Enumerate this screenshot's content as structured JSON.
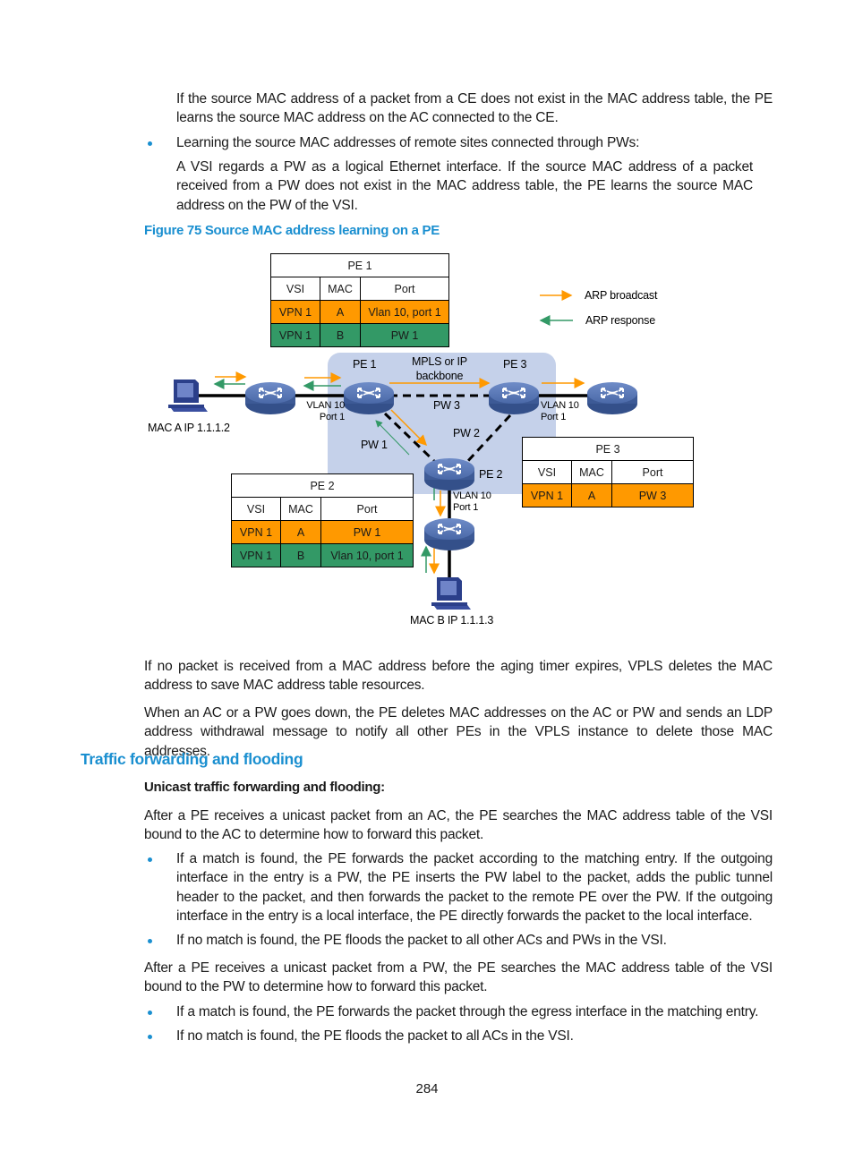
{
  "document": {
    "intro_paragraph": "If the source MAC address of a packet from a CE does not exist in the MAC address table, the PE learns the source MAC address on the AC connected to the CE.",
    "bullet_remote": "Learning the source MAC addresses of remote sites connected through PWs:",
    "remote_paragraph": "A VSI regards a PW as a logical Ethernet interface. If the source MAC address of a packet received from a PW does not exist in the MAC address table, the PE learns the source MAC address on the PW of the VSI.",
    "figure_title": "Figure 75 Source MAC address learning on a PE",
    "aging_paragraph": "If no packet is received from a MAC address before the aging timer expires, VPLS deletes the MAC address to save MAC address table resources.",
    "withdraw_paragraph": "When an AC or a PW goes down, the PE deletes MAC addresses on the AC or PW and sends an LDP address withdrawal message to notify all other PEs in the VPLS instance to delete those MAC addresses.",
    "section_heading": "Traffic forwarding and flooding",
    "subheading": "Unicast traffic forwarding and flooding:",
    "ac_paragraph": "After a PE receives a unicast packet from an AC, the PE searches the MAC address table of the VSI bound to the AC to determine how to forward this packet.",
    "ac_bullets": [
      "If a match is found, the PE forwards the packet according to the matching entry. If the outgoing interface in the entry is a PW, the PE inserts the PW label to the packet, adds the public tunnel header to the packet, and then forwards the packet to the remote PE over the PW. If the outgoing interface in the entry is a local interface, the PE directly forwards the packet to the local interface.",
      "If no match is found, the PE floods the packet to all other ACs and PWs in the VSI."
    ],
    "pw_paragraph": "After a PE receives a unicast packet from a PW, the PE searches the MAC address table of the VSI bound to the PW to determine how to forward this packet.",
    "pw_bullets": [
      "If a match is found, the PE forwards the packet through the egress interface in the matching entry.",
      "If no match is found, the PE floods the packet to all ACs in the VSI."
    ],
    "page_number": "284"
  },
  "diagram": {
    "colors": {
      "broadcast": "#ff9900",
      "response": "#339966",
      "backbone": "#c5d1ea",
      "device": "#4a69a8",
      "heading": "#1a8fd0"
    },
    "legend": {
      "broadcast": "ARP broadcast",
      "response": "ARP response"
    },
    "backbone_label": [
      "MPLS or IP",
      "backbone"
    ],
    "nodes": {
      "pe1": "PE 1",
      "pe2": "PE 2",
      "pe3": "PE 3",
      "host_a": "MAC A IP 1.1.1.2",
      "host_b": "MAC B IP 1.1.1.3"
    },
    "port_labels": {
      "pe1": [
        "VLAN 10",
        "Port 1"
      ],
      "pe3": [
        "VLAN 10",
        "Port 1"
      ],
      "pe2": [
        "VLAN 10",
        "Port 1"
      ]
    },
    "pw_labels": {
      "pw1": "PW 1",
      "pw2": "PW 2",
      "pw3": "PW 3"
    },
    "tables": {
      "pe1": {
        "title": "PE 1",
        "headers": [
          "VSI",
          "MAC",
          "Port"
        ],
        "rows": [
          {
            "vsi": "VPN 1",
            "mac": "A",
            "port": "Vlan 10, port 1",
            "color": "orange"
          },
          {
            "vsi": "VPN 1",
            "mac": "B",
            "port": "PW 1",
            "color": "green"
          }
        ]
      },
      "pe2": {
        "title": "PE 2",
        "headers": [
          "VSI",
          "MAC",
          "Port"
        ],
        "rows": [
          {
            "vsi": "VPN 1",
            "mac": "A",
            "port": "PW 1",
            "color": "orange"
          },
          {
            "vsi": "VPN 1",
            "mac": "B",
            "port": "Vlan 10, port 1",
            "color": "green"
          }
        ]
      },
      "pe3": {
        "title": "PE 3",
        "headers": [
          "VSI",
          "MAC",
          "Port"
        ],
        "rows": [
          {
            "vsi": "VPN 1",
            "mac": "A",
            "port": "PW 3",
            "color": "orange"
          }
        ]
      }
    }
  }
}
